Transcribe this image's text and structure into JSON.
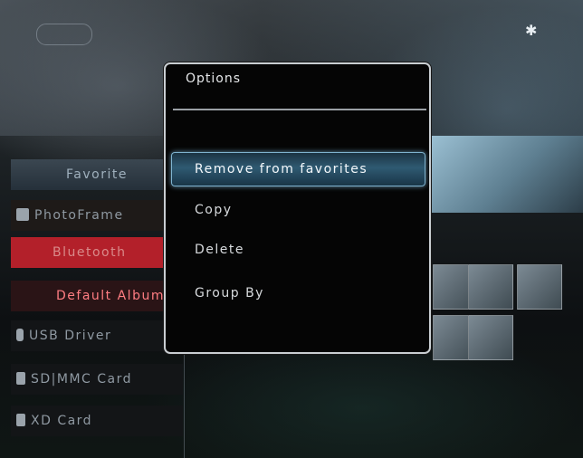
{
  "icons": {
    "status": "bluetooth-icon",
    "photoframe": "photoframe-icon",
    "usb": "usb-icon",
    "sdcard": "sd-card-icon",
    "xdcard": "xd-card-icon"
  },
  "sidebar": {
    "items": [
      {
        "label": "Favorite"
      },
      {
        "label": "PhotoFrame"
      },
      {
        "label": "Bluetooth"
      },
      {
        "label": "Default Album"
      },
      {
        "label": "USB Driver"
      },
      {
        "label": "SD|MMC Card"
      },
      {
        "label": "XD Card"
      }
    ]
  },
  "dialog": {
    "title": "Options",
    "options": [
      {
        "label": "Remove from favorites",
        "selected": true
      },
      {
        "label": "Copy"
      },
      {
        "label": "Delete"
      },
      {
        "label": "Group By"
      }
    ]
  },
  "colors": {
    "selection_glow": "#7fb3cf",
    "bluetooth_bg": "#b3202a",
    "dialog_border": "#c9ced2"
  }
}
